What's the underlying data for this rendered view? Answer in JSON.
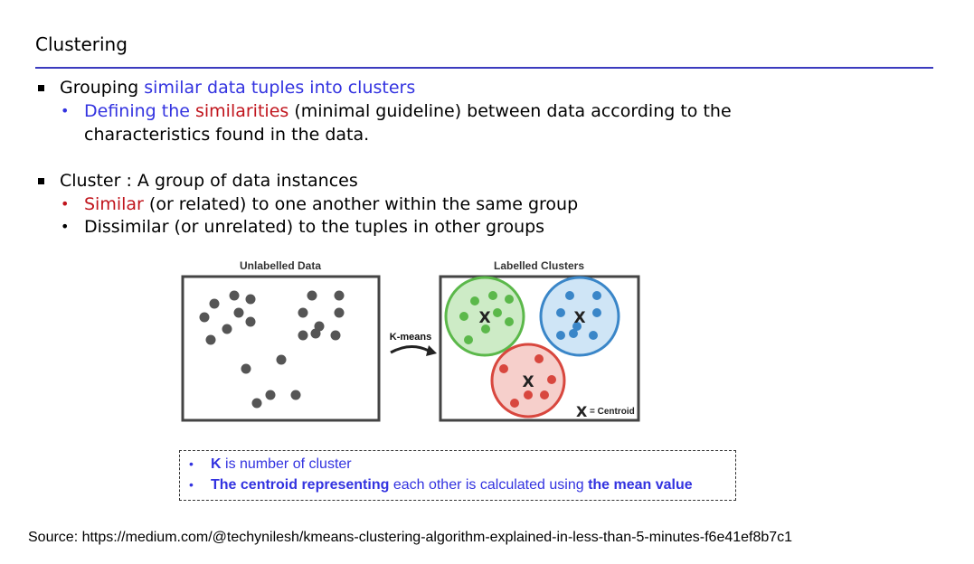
{
  "slide": {
    "title": "Clustering"
  },
  "bullets": {
    "b1_prefix": "Grouping ",
    "b1_highlight": "similar data tuples into clusters",
    "b1_sub_blue": "Defining the ",
    "b1_sub_red": "similarities",
    "b1_sub_rest_line1": " (minimal guideline) between data according to the",
    "b1_sub_line2": "characteristics found in the data.",
    "b2_text": "Cluster : A group of data instances",
    "b2_sub1_red": "Similar",
    "b2_sub1_rest": " (or related) to one another within the same group",
    "b2_sub2": "Dissimilar (or unrelated) to the tuples in other groups"
  },
  "figure": {
    "left_title": "Unlabelled Data",
    "right_title": "Labelled Clusters",
    "arrow_label": "K-means",
    "centroid_legend": "= Centroid",
    "centroid_mark": "X",
    "colors": {
      "green": "#5bb84a",
      "blue": "#3a86c8",
      "red": "#d8473e",
      "gray": "#555555"
    }
  },
  "note": {
    "line1_bold": "K",
    "line1_rest": " is number of cluster",
    "line2_bold1": "The centroid representing",
    "line2_mid": " each other is calculated using ",
    "line2_bold2": "the mean value"
  },
  "source": "Source: https://medium.com/@techynilesh/kmeans-clustering-algorithm-explained-in-less-than-5-minutes-f6e41ef8b7c1"
}
